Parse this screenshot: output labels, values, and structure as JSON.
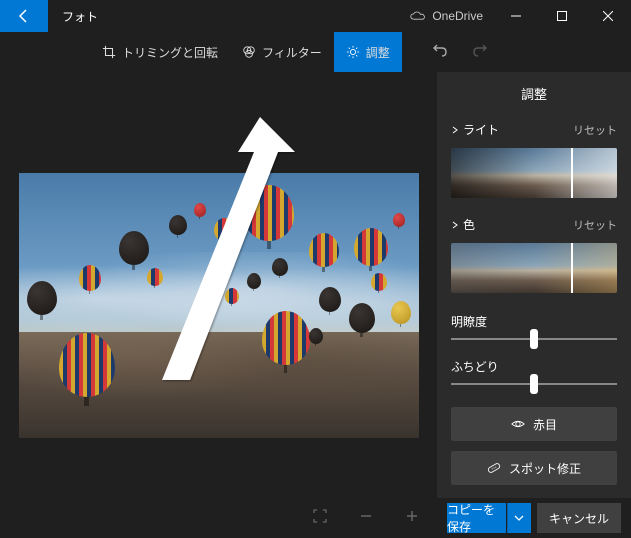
{
  "titlebar": {
    "title": "フォト",
    "onedrive": "OneDrive"
  },
  "toolbar": {
    "crop": "トリミングと回転",
    "filter": "フィルター",
    "adjust": "調整"
  },
  "panel": {
    "title": "調整",
    "light": {
      "label": "ライト",
      "reset": "リセット",
      "pos": 72
    },
    "color": {
      "label": "色",
      "reset": "リセット",
      "pos": 72
    },
    "clarity": {
      "label": "明瞭度",
      "pos": 50
    },
    "vignette": {
      "label": "ふちどり",
      "pos": 50
    },
    "redeye": "赤目",
    "spotfix": "スポット修正"
  },
  "footer": {
    "save": "コピーを保存",
    "cancel": "キャンセル"
  }
}
